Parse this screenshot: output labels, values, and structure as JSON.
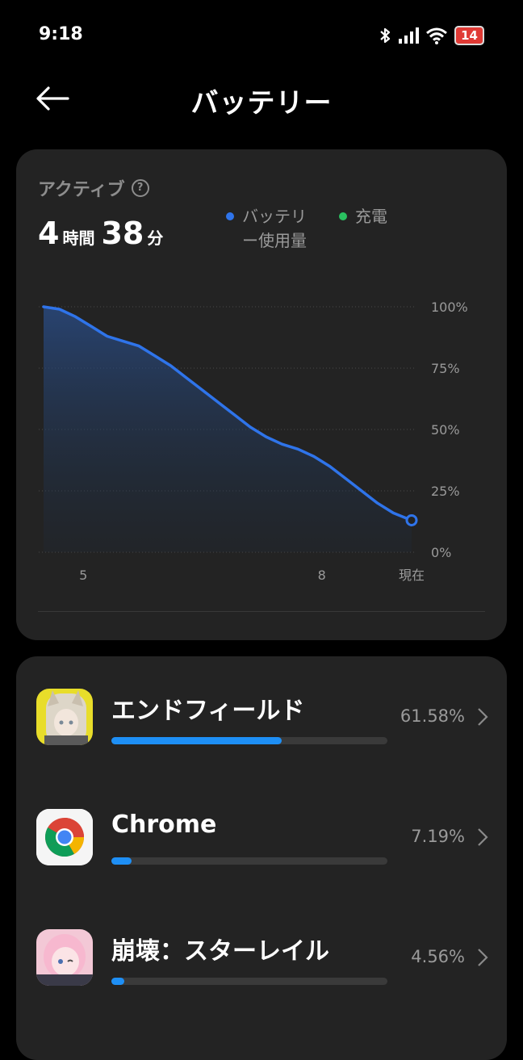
{
  "status_bar": {
    "time": "9:18",
    "battery_level": "14",
    "icons": [
      "bluetooth-icon",
      "signal-icon",
      "wifi-icon",
      "battery-icon"
    ]
  },
  "header": {
    "title": "バッテリー",
    "back_icon": "back-arrow-icon"
  },
  "usage_card": {
    "active_label": "アクティブ",
    "help_icon": "help-icon",
    "active_hours": "4",
    "hours_unit": "時間",
    "active_minutes": "38",
    "minutes_unit": "分",
    "legend": [
      {
        "label_line1": "バッテリ",
        "label_line2": "ー使用量",
        "color": "#2f74ea"
      },
      {
        "label_line1": "充電",
        "label_line2": "",
        "color": "#2ac060"
      }
    ]
  },
  "chart_data": {
    "type": "area",
    "series": [
      {
        "name": "バッテリー使用量",
        "color": "#2f74ea",
        "x": [
          0,
          0.2,
          0.4,
          0.6,
          0.8,
          1.0,
          1.2,
          1.4,
          1.6,
          1.8,
          2.0,
          2.2,
          2.4,
          2.6,
          2.8,
          3.0,
          3.2,
          3.4,
          3.6,
          3.8,
          4.0,
          4.2,
          4.4,
          4.63
        ],
        "values": [
          100,
          99,
          96,
          92,
          88,
          86,
          84,
          80,
          76,
          71,
          66,
          61,
          56,
          51,
          47,
          44,
          42,
          39,
          35,
          30,
          25,
          20,
          16,
          13
        ]
      }
    ],
    "x_ticks": [
      {
        "x": 0.5,
        "label": "5"
      },
      {
        "x": 3.5,
        "label": "8"
      },
      {
        "x": 4.63,
        "label": "現在"
      }
    ],
    "y_ticks": [
      "0%",
      "25%",
      "50%",
      "75%",
      "100%"
    ],
    "ylim": [
      0,
      100
    ],
    "xlim": [
      0,
      4.63
    ],
    "grid": true
  },
  "apps": [
    {
      "name": "エンドフィールド",
      "percent": "61.58%",
      "fraction": 0.6158,
      "icon": "endfield-app-icon"
    },
    {
      "name": "Chrome",
      "percent": "7.19%",
      "fraction": 0.0719,
      "icon": "chrome-app-icon"
    },
    {
      "name": "崩壊：スターレイル",
      "percent": "4.56%",
      "fraction": 0.0456,
      "icon": "star-rail-app-icon"
    }
  ]
}
